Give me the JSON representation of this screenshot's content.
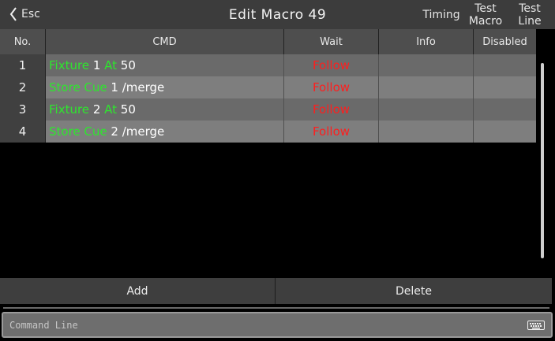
{
  "header": {
    "esc_label": "Esc",
    "title": "Edit Macro 49",
    "timing_label": "Timing",
    "test_macro_label_1": "Test",
    "test_macro_label_2": "Macro",
    "test_line_label_1": "Test",
    "test_line_label_2": "Line"
  },
  "table": {
    "columns": [
      "No.",
      "CMD",
      "Wait",
      "Info",
      "Disabled"
    ],
    "rows": [
      {
        "no": "1",
        "cmd_kw1": "Fixture",
        "cmd_v1": " 1 ",
        "cmd_kw2": "At",
        "cmd_v2": " 50",
        "wait": "Follow",
        "info": "",
        "disabled": ""
      },
      {
        "no": "2",
        "cmd_kw1": "Store Cue",
        "cmd_v1": " 1 /merge",
        "wait": "Follow",
        "info": "",
        "disabled": ""
      },
      {
        "no": "3",
        "cmd_kw1": "Fixture",
        "cmd_v1": " 2 ",
        "cmd_kw2": "At",
        "cmd_v2": " 50",
        "wait": "Follow",
        "info": "",
        "disabled": ""
      },
      {
        "no": "4",
        "cmd_kw1": "Store Cue",
        "cmd_v1": " 2 /merge",
        "wait": "Follow",
        "info": "",
        "disabled": ""
      }
    ]
  },
  "actions": {
    "add_label": "Add",
    "delete_label": "Delete"
  },
  "command_line": {
    "placeholder": "Command Line",
    "value": ""
  },
  "icons": {
    "back": "chevron-left-icon",
    "keyboard": "keyboard-icon"
  },
  "colors": {
    "keyword": "#2ee62e",
    "wait": "#ff1e1e",
    "header_bg": "#3c3c3c"
  }
}
